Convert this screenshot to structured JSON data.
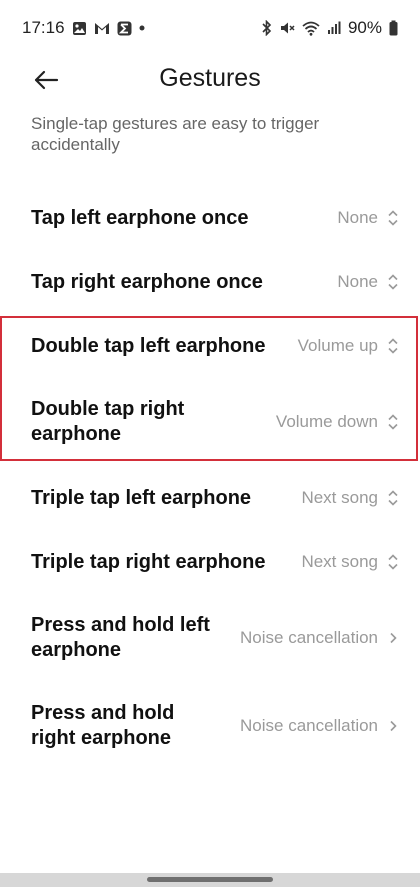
{
  "status_bar": {
    "time": "17:16",
    "notification_icons": [
      "photo-icon",
      "gmail-icon",
      "sigma-app-icon",
      "dot-icon"
    ],
    "system_icons": [
      "bluetooth-icon",
      "mute-icon",
      "wifi-icon",
      "signal-icon"
    ],
    "battery_percent": "90%"
  },
  "header": {
    "title": "Gestures",
    "back_icon": "arrow-left-icon"
  },
  "subtitle": "Single-tap gestures are easy to trigger accidentally",
  "gestures": [
    {
      "label": "Tap left earphone once",
      "value": "None",
      "control": "updown"
    },
    {
      "label": "Tap right earphone once",
      "value": "None",
      "control": "updown"
    },
    {
      "label": "Double tap left earphone",
      "value": "Volume up",
      "control": "updown"
    },
    {
      "label": "Double tap right earphone",
      "value": "Volume down",
      "control": "updown"
    },
    {
      "label": "Triple tap left earphone",
      "value": "Next song",
      "control": "updown"
    },
    {
      "label": "Triple tap right earphone",
      "value": "Next song",
      "control": "updown"
    },
    {
      "label": "Press and hold left earphone",
      "value": "Noise cancellation",
      "control": "right"
    },
    {
      "label": "Press and hold right earphone",
      "value": "Noise cancellation",
      "control": "right"
    }
  ],
  "colors": {
    "highlight": "#d32f3a",
    "value_text": "#9a9a9a",
    "subtitle_text": "#666666"
  }
}
